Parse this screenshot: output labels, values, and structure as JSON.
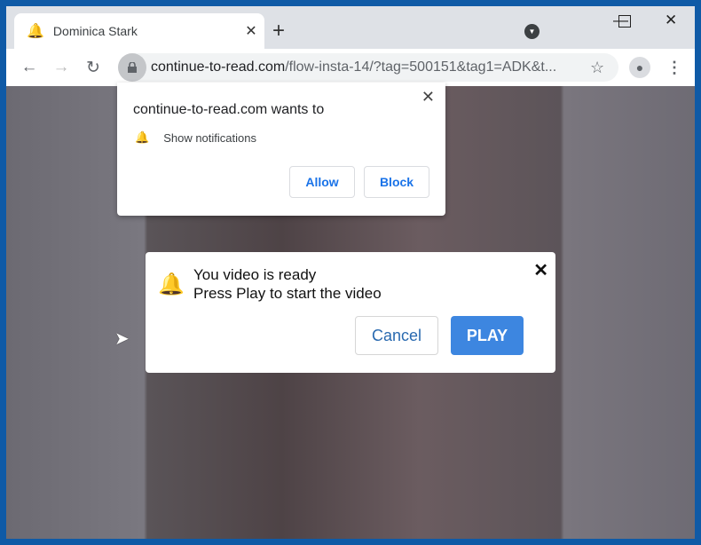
{
  "tab": {
    "title": "Dominica Stark",
    "favicon": "red-bell-icon"
  },
  "address": {
    "domain": "continue-to-read.com",
    "path": "/flow-insta-14/?tag=500151&tag1=ADK&t..."
  },
  "permission_prompt": {
    "heading": "continue-to-read.com wants to",
    "item": "Show notifications",
    "allow": "Allow",
    "block": "Block"
  },
  "dialog": {
    "line1": "You video is ready",
    "line2": "Press Play to start the video",
    "cancel": "Cancel",
    "play": "PLAY"
  },
  "colors": {
    "accent": "#3d86e0",
    "frame": "#0f5aa6",
    "bell": "#e0141e"
  }
}
